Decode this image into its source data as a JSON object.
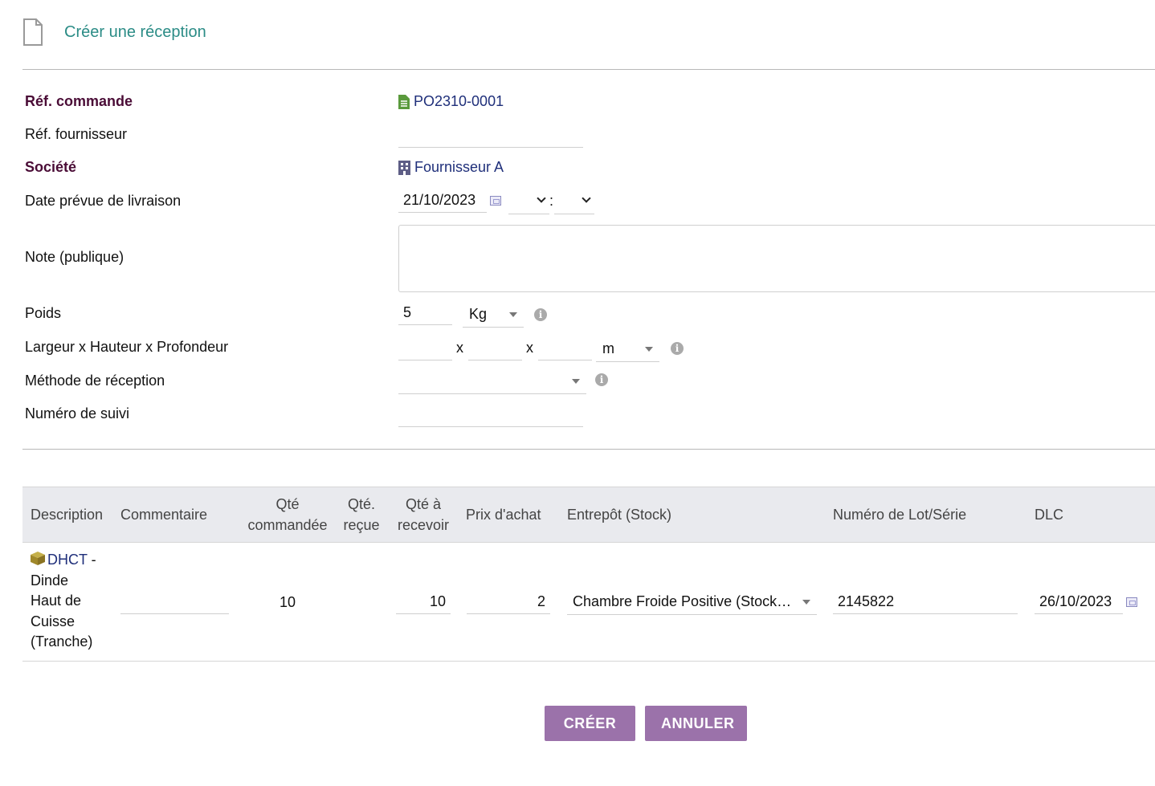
{
  "page": {
    "title": "Créer une réception"
  },
  "form": {
    "ref_commande": {
      "label": "Réf. commande",
      "value": "PO2310-0001"
    },
    "ref_fournisseur": {
      "label": "Réf. fournisseur",
      "value": ""
    },
    "societe": {
      "label": "Société",
      "value": "Fournisseur A"
    },
    "date_livraison": {
      "label": "Date prévue de livraison",
      "date": "21/10/2023",
      "hour": "",
      "minute": "",
      "time_sep": ":"
    },
    "note_publique": {
      "label": "Note (publique)",
      "value": ""
    },
    "poids": {
      "label": "Poids",
      "value": "5",
      "unit": "Kg"
    },
    "dimensions": {
      "label": "Largeur x Hauteur x Profondeur",
      "sep": "x",
      "largeur": "",
      "hauteur": "",
      "profondeur": "",
      "unit": "m"
    },
    "methode": {
      "label": "Méthode de réception",
      "value": ""
    },
    "suivi": {
      "label": "Numéro de suivi",
      "value": ""
    }
  },
  "table": {
    "headers": {
      "description": "Description",
      "commentaire": "Commentaire",
      "qte_commandee_1": "Qté",
      "qte_commandee_2": "commandée",
      "qte_recue_1": "Qté.",
      "qte_recue_2": "reçue",
      "qte_a_recevoir_1": "Qté à",
      "qte_a_recevoir_2": "recevoir",
      "prix_achat": "Prix d'achat",
      "entrepot": "Entrepôt (Stock)",
      "lot": "Numéro de Lot/Série",
      "dlc": "DLC"
    },
    "rows": [
      {
        "product_ref": "DHCT",
        "desc_sep": " -",
        "desc_lines": [
          "Dinde",
          "Haut de",
          "Cuisse",
          "(Tranche)"
        ],
        "commentaire": "",
        "qte_commandee": "10",
        "qte_recue": "",
        "qte_a_recevoir": "10",
        "prix_achat": "2",
        "entrepot": "Chambre Froide Positive (Stock…",
        "lot": "2145822",
        "dlc": "26/10/2023"
      }
    ]
  },
  "buttons": {
    "create": "CRÉER",
    "cancel": "ANNULER"
  },
  "colors": {
    "accent": "#9b72aa",
    "title": "#2b8c86",
    "required_label": "#4a0c36",
    "link": "#1f2f7a"
  }
}
